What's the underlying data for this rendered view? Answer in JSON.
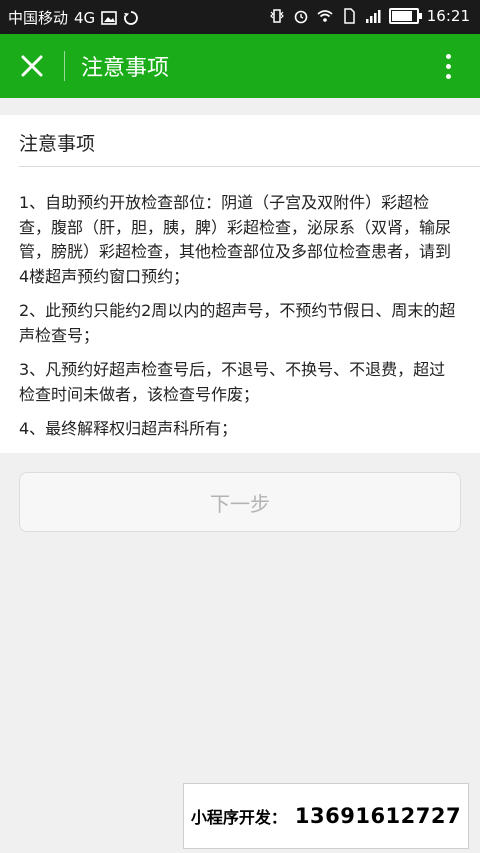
{
  "status_bar": {
    "carrier": "中国移动",
    "network": "4G",
    "time": "16:21",
    "battery_level": 0.9
  },
  "nav": {
    "title": "注意事项"
  },
  "notice": {
    "heading": "注意事项",
    "items": [
      "1、自助预约开放检查部位：阴道（子宫及双附件）彩超检查，腹部（肝，胆，胰，脾）彩超检查，泌尿系（双肾，输尿管，膀胱）彩超检查，其他检查部位及多部位检查患者，请到4楼超声预约窗口预约；",
      "2、此预约只能约2周以内的超声号，不预约节假日、周末的超声检查号；",
      "3、凡预约好超声检查号后，不退号、不换号、不退费，超过检查时间未做者，该检查号作废；",
      "4、最终解释权归超声科所有；"
    ]
  },
  "next_button": {
    "label": "下一步"
  },
  "ad": {
    "label": "小程序开发：",
    "phone": "13691612727"
  },
  "colors": {
    "nav_bg": "#1aad19",
    "page_bg": "#f0f0f0",
    "status_bg": "#1a1a1a"
  }
}
